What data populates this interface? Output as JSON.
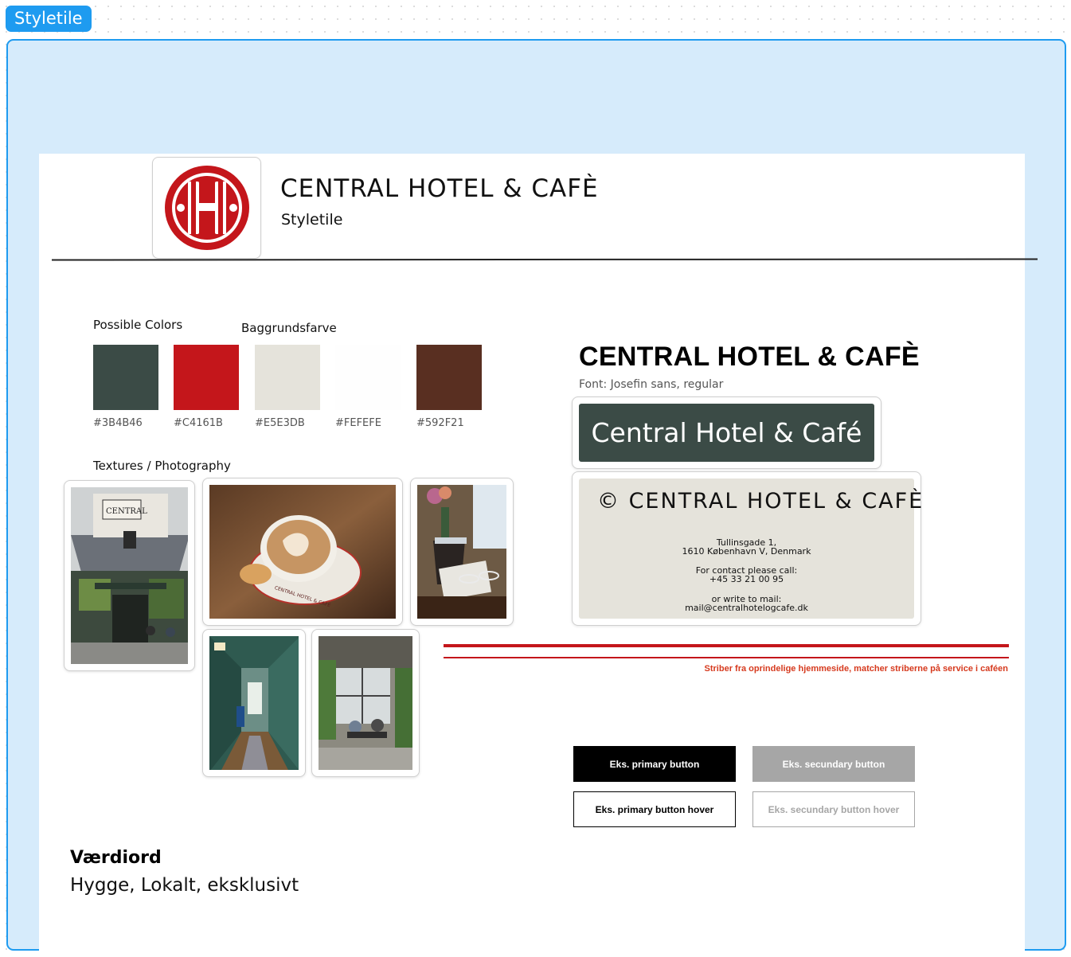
{
  "frame": {
    "label": "Styletile"
  },
  "header": {
    "logo_icon": "hotel-h-logo",
    "title": "CENTRAL HOTEL & CAFÈ",
    "subtitle": "Styletile"
  },
  "colors": {
    "heading": "Possible Colors",
    "background_heading": "Baggrundsfarve",
    "swatches": [
      {
        "hex": "#3B4B46",
        "color": "#3b4b46"
      },
      {
        "hex": "#C4161B",
        "color": "#c4161b"
      },
      {
        "hex": "#E5E3DB",
        "color": "#e5e3db"
      },
      {
        "hex": "#FEFEFE",
        "color": "#fefefe"
      },
      {
        "hex": "#592F21",
        "color": "#592f21"
      }
    ]
  },
  "photos": {
    "heading": "Textures / Photography",
    "items": [
      {
        "name": "hotel-facade-photo",
        "sign_text": "CENTRAL"
      },
      {
        "name": "cappuccino-photo",
        "cup_text": "CENTRAL HOTEL & CAFÉ"
      },
      {
        "name": "champagne-bucket-photo"
      },
      {
        "name": "hallway-photo"
      },
      {
        "name": "cafe-terrace-photo"
      }
    ]
  },
  "typography": {
    "title": "CENTRAL HOTEL & CAFÈ",
    "font_note": "Font: Josefin sans, regular",
    "sample_button": "Central Hotel & Café"
  },
  "business_card": {
    "title": "© CENTRAL HOTEL & CAFÈ",
    "address_line1": "Tullinsgade 1,",
    "address_line2": "1610 København V, Denmark",
    "contact_line1": "For contact please call:",
    "contact_line2": "+45 33 21 00 95",
    "mail_line1": "or write to mail:",
    "mail_line2": "mail@centralhotelogcafe.dk"
  },
  "stripes": {
    "note": "Striber fra oprindelige hjemmeside, matcher striberne på service i caféen",
    "color": "#c4161b"
  },
  "buttons": {
    "primary": "Eks. primary button",
    "secondary": "Eks. secundary  button",
    "primary_hover": "Eks. primary button hover",
    "secondary_hover": "Eks. secundary button hover"
  },
  "values": {
    "title": "Værdiord",
    "text": "Hygge, Lokalt, eksklusivt"
  }
}
